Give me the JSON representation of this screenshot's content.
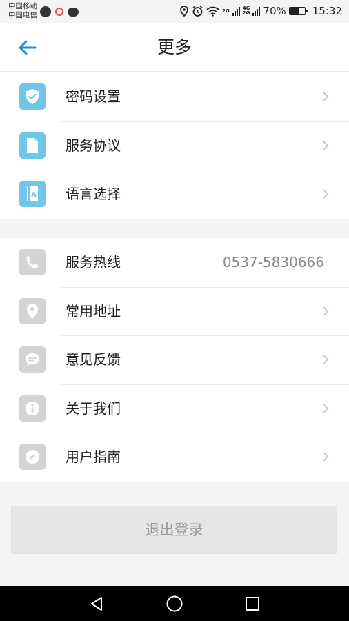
{
  "status_bar": {
    "carrier_1": "中国移动",
    "carrier_2": "中国电信",
    "network_1": "2G",
    "network_2": "4G",
    "network_3": "2G",
    "battery_percent": "70%",
    "battery_level": 0.7,
    "time": "15:32"
  },
  "header": {
    "title": "更多",
    "back_icon": "back-arrow-icon"
  },
  "colors": {
    "accent_blue": "#1d8fd6",
    "icon_blue": "#6fc6e9",
    "icon_gray": "#d4d4d4"
  },
  "group1": [
    {
      "label": "密码设置",
      "icon": "shield-check-icon"
    },
    {
      "label": "服务协议",
      "icon": "document-icon"
    },
    {
      "label": "语言选择",
      "icon": "language-book-icon"
    }
  ],
  "group2": [
    {
      "label": "服务热线",
      "icon": "phone-icon",
      "value": "0537-5830666"
    },
    {
      "label": "常用地址",
      "icon": "location-pin-icon"
    },
    {
      "label": "意见反馈",
      "icon": "feedback-chat-icon"
    },
    {
      "label": "关于我们",
      "icon": "info-icon"
    },
    {
      "label": "用户指南",
      "icon": "compass-icon"
    }
  ],
  "logout_label": "退出登录"
}
